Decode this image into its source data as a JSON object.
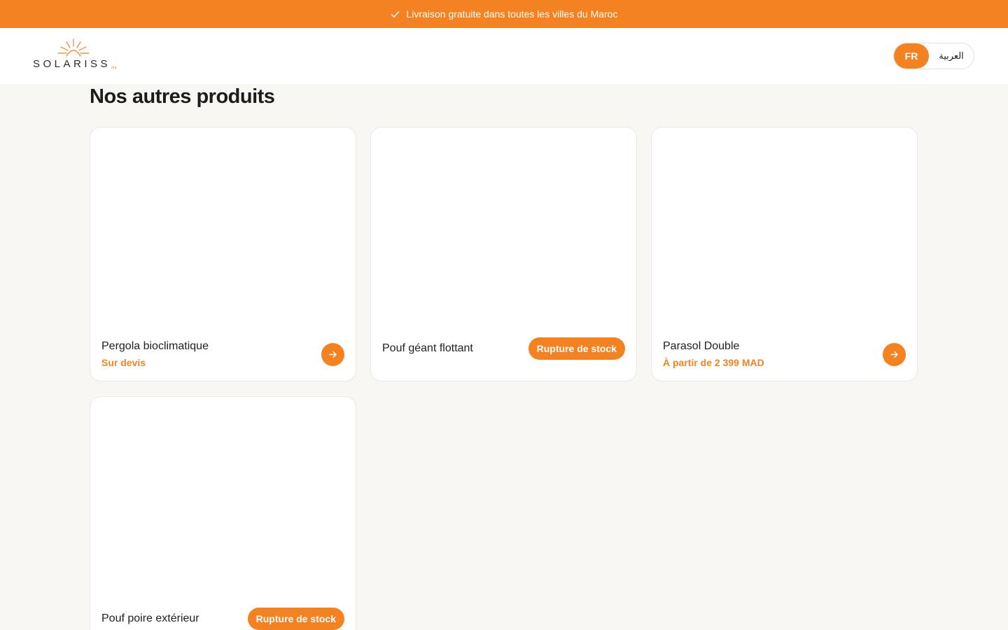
{
  "announcement": {
    "text": "Livraison gratuite dans toutes les villes du Maroc",
    "icon": "check-icon"
  },
  "header": {
    "logo_text": "SOLARISS",
    "logo_suffix": "ma",
    "logo_icon": "sun-icon",
    "languages": [
      {
        "label": "FR",
        "active": true
      },
      {
        "label": "العربية",
        "active": false
      }
    ]
  },
  "section": {
    "title": "Nos autres produits"
  },
  "products": [
    {
      "name": "Pergola bioclimatique",
      "price": "Sur devis",
      "action": "arrow-right-icon"
    },
    {
      "name": "Pouf géant flottant",
      "badge": "Rupture de stock"
    },
    {
      "name": "Parasol Double",
      "price": "À partir de 2 399 MAD",
      "action": "arrow-right-icon"
    },
    {
      "name": "Pouf poire extérieur",
      "badge": "Rupture de stock"
    }
  ],
  "colors": {
    "accent": "#f58220",
    "background": "#f9f7f3",
    "card": "#ffffff"
  }
}
